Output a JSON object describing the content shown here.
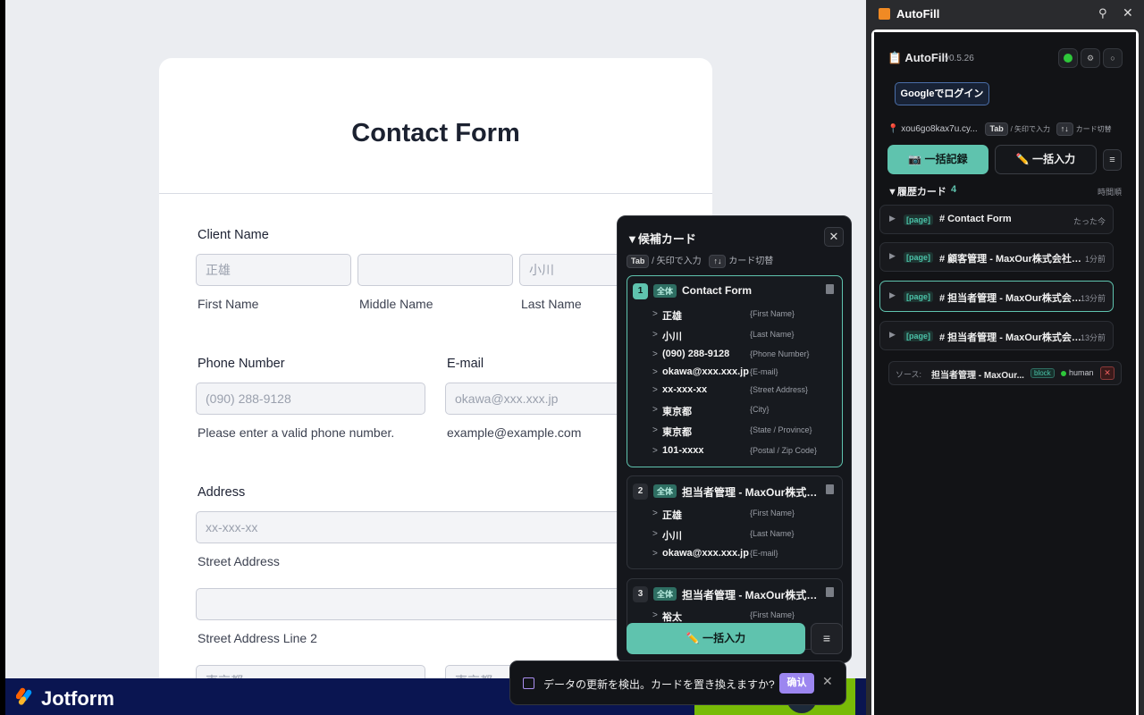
{
  "form": {
    "title": "Contact Form",
    "client_name": {
      "label": "Client Name",
      "first": {
        "placeholder": "正雄",
        "sub": "First Name"
      },
      "middle": {
        "placeholder": "",
        "sub": "Middle Name"
      },
      "last": {
        "placeholder": "小川",
        "sub": "Last Name"
      }
    },
    "phone": {
      "label": "Phone Number",
      "placeholder": "(090) 288-9128",
      "sub": "Please enter a valid phone number."
    },
    "email": {
      "label": "E-mail",
      "placeholder": "okawa@xxx.xxx.jp",
      "sub": "example@example.com"
    },
    "address": {
      "label": "Address",
      "street": {
        "placeholder": "xx-xxx-xx",
        "sub": "Street Address"
      },
      "street2": {
        "placeholder": "",
        "sub": "Street Address Line 2"
      },
      "city_placeholder": "東京都",
      "state_placeholder": "東京都"
    }
  },
  "jotform": {
    "brand": "Jotform"
  },
  "sidebar": {
    "window_title": "AutoFill",
    "brand": "📋 AutoFill",
    "version": "v0.5.26",
    "login_label": "Googleでログイン",
    "host": "📍 xou6go8kax7u.cy...",
    "hint_tab": "Tab",
    "hint_tab_text": "/ 矢印で入力",
    "hint_arrows": "↑↓",
    "hint_arrows_text": "カード切替",
    "record_label": "📷 一括記録",
    "fill_label": "✏️ 一括入力",
    "menu_label": "≡",
    "history_title": "▼履歴カード",
    "history_count": "4",
    "sort_label": "時間順",
    "history": [
      {
        "tag": "[page]",
        "name": "# Contact Form",
        "time": "たった今"
      },
      {
        "tag": "[page]",
        "name": "# 顧客管理 - MaxOur株式会社 - 顧客一覧",
        "time": "1分前"
      },
      {
        "tag": "[page]",
        "name": "# 担当者管理 - MaxOur株式会社 - 担当者一覧",
        "time": "13分前"
      },
      {
        "tag": "[page]",
        "name": "# 担当者管理 - MaxOur株式会社 - 担当者一覧",
        "time": "13分前"
      }
    ],
    "source": {
      "label": "ソース:",
      "name": "担当者管理 - MaxOur...",
      "block": "block",
      "human": "human",
      "remove": "✕"
    }
  },
  "candidates": {
    "title": "▼候補カード",
    "close": "✕",
    "hint_tab": "Tab",
    "hint_tab_text": "/ 矢印で入力",
    "hint_arrows": "↑↓",
    "hint_arrows_text": "カード切替",
    "cards": [
      {
        "num": "1",
        "badge": "全体",
        "title": "Contact Form",
        "rows": [
          {
            "value": "正雄",
            "field": "{First Name}"
          },
          {
            "value": "小川",
            "field": "{Last Name}"
          },
          {
            "value": "(090) 288-9128",
            "field": "{Phone Number}"
          },
          {
            "value": "okawa@xxx.xxx.jp",
            "field": "{E-mail}"
          },
          {
            "value": "xx-xxx-xx",
            "field": "{Street Address}"
          },
          {
            "value": "東京都",
            "field": "{City}"
          },
          {
            "value": "東京都",
            "field": "{State / Province}"
          },
          {
            "value": "101-xxxx",
            "field": "{Postal / Zip Code}"
          }
        ]
      },
      {
        "num": "2",
        "badge": "全体",
        "title": "担当者管理 - MaxOur株式会社 - 担当者一覧",
        "rows": [
          {
            "value": "正雄",
            "field": "{First Name}"
          },
          {
            "value": "小川",
            "field": "{Last Name}"
          },
          {
            "value": "okawa@xxx.xxx.jp",
            "field": "{E-mail}"
          }
        ]
      },
      {
        "num": "3",
        "badge": "全体",
        "title": "担当者管理 - MaxOur株式会社 - 担当者一覧",
        "rows": [
          {
            "value": "裕太",
            "field": "{First Name}"
          }
        ]
      }
    ],
    "fill_label": "✏️ 一括入力",
    "menu_label": "≡"
  },
  "toast": {
    "message": "データの更新を検出。カードを置き換えますか?",
    "confirm": "确认",
    "close": "✕"
  }
}
